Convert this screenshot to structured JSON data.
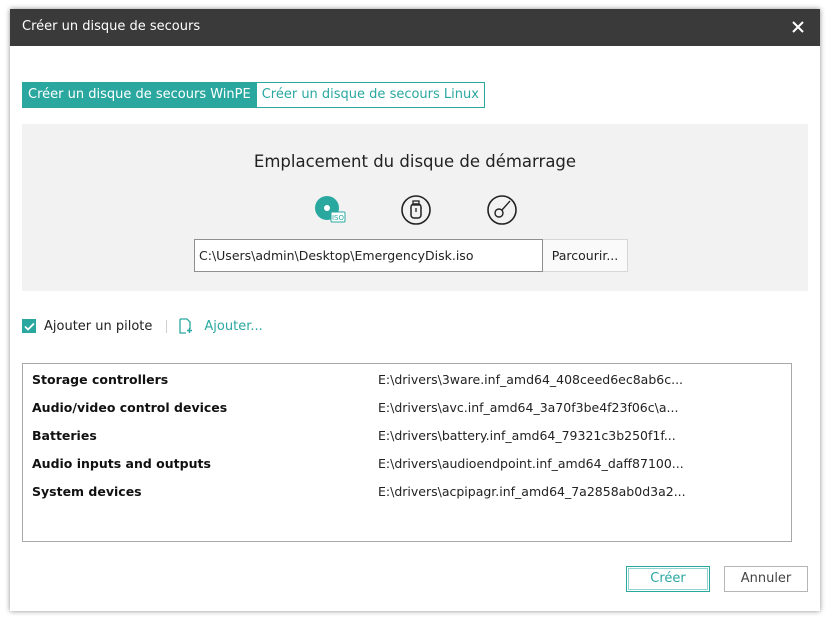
{
  "window": {
    "title": "Créer un disque de secours"
  },
  "tabs": [
    {
      "label": "Créer un disque de secours WinPE",
      "active": true
    },
    {
      "label": "Créer un disque de secours Linux",
      "active": false
    }
  ],
  "boot": {
    "heading": "Emplacement du disque de démarrage",
    "media_icons": [
      "iso-icon",
      "usb-icon",
      "cd-icon"
    ],
    "selected_media": "iso-icon",
    "path_value": "C:\\Users\\admin\\Desktop\\EmergencyDisk.iso",
    "browse_label": "Parcourir..."
  },
  "driver": {
    "checkbox_label": "Ajouter un pilote",
    "checked": true,
    "add_label": "Ajouter..."
  },
  "drivers": [
    {
      "name": "Storage controllers",
      "path": "E:\\drivers\\3ware.inf_amd64_408ceed6ec8ab6c..."
    },
    {
      "name": "Audio/video control devices",
      "path": "E:\\drivers\\avc.inf_amd64_3a70f3be4f23f06c\\a..."
    },
    {
      "name": "Batteries",
      "path": "E:\\drivers\\battery.inf_amd64_79321c3b250f1f..."
    },
    {
      "name": "Audio inputs and outputs",
      "path": "E:\\drivers\\audioendpoint.inf_amd64_daff87100..."
    },
    {
      "name": "System devices",
      "path": "E:\\drivers\\acpipagr.inf_amd64_7a2858ab0d3a2..."
    }
  ],
  "footer": {
    "create_label": "Créer",
    "cancel_label": "Annuler"
  },
  "colors": {
    "accent": "#2aa8a0",
    "titlebar": "#3a3a3a",
    "panel": "#f2f2f2"
  }
}
